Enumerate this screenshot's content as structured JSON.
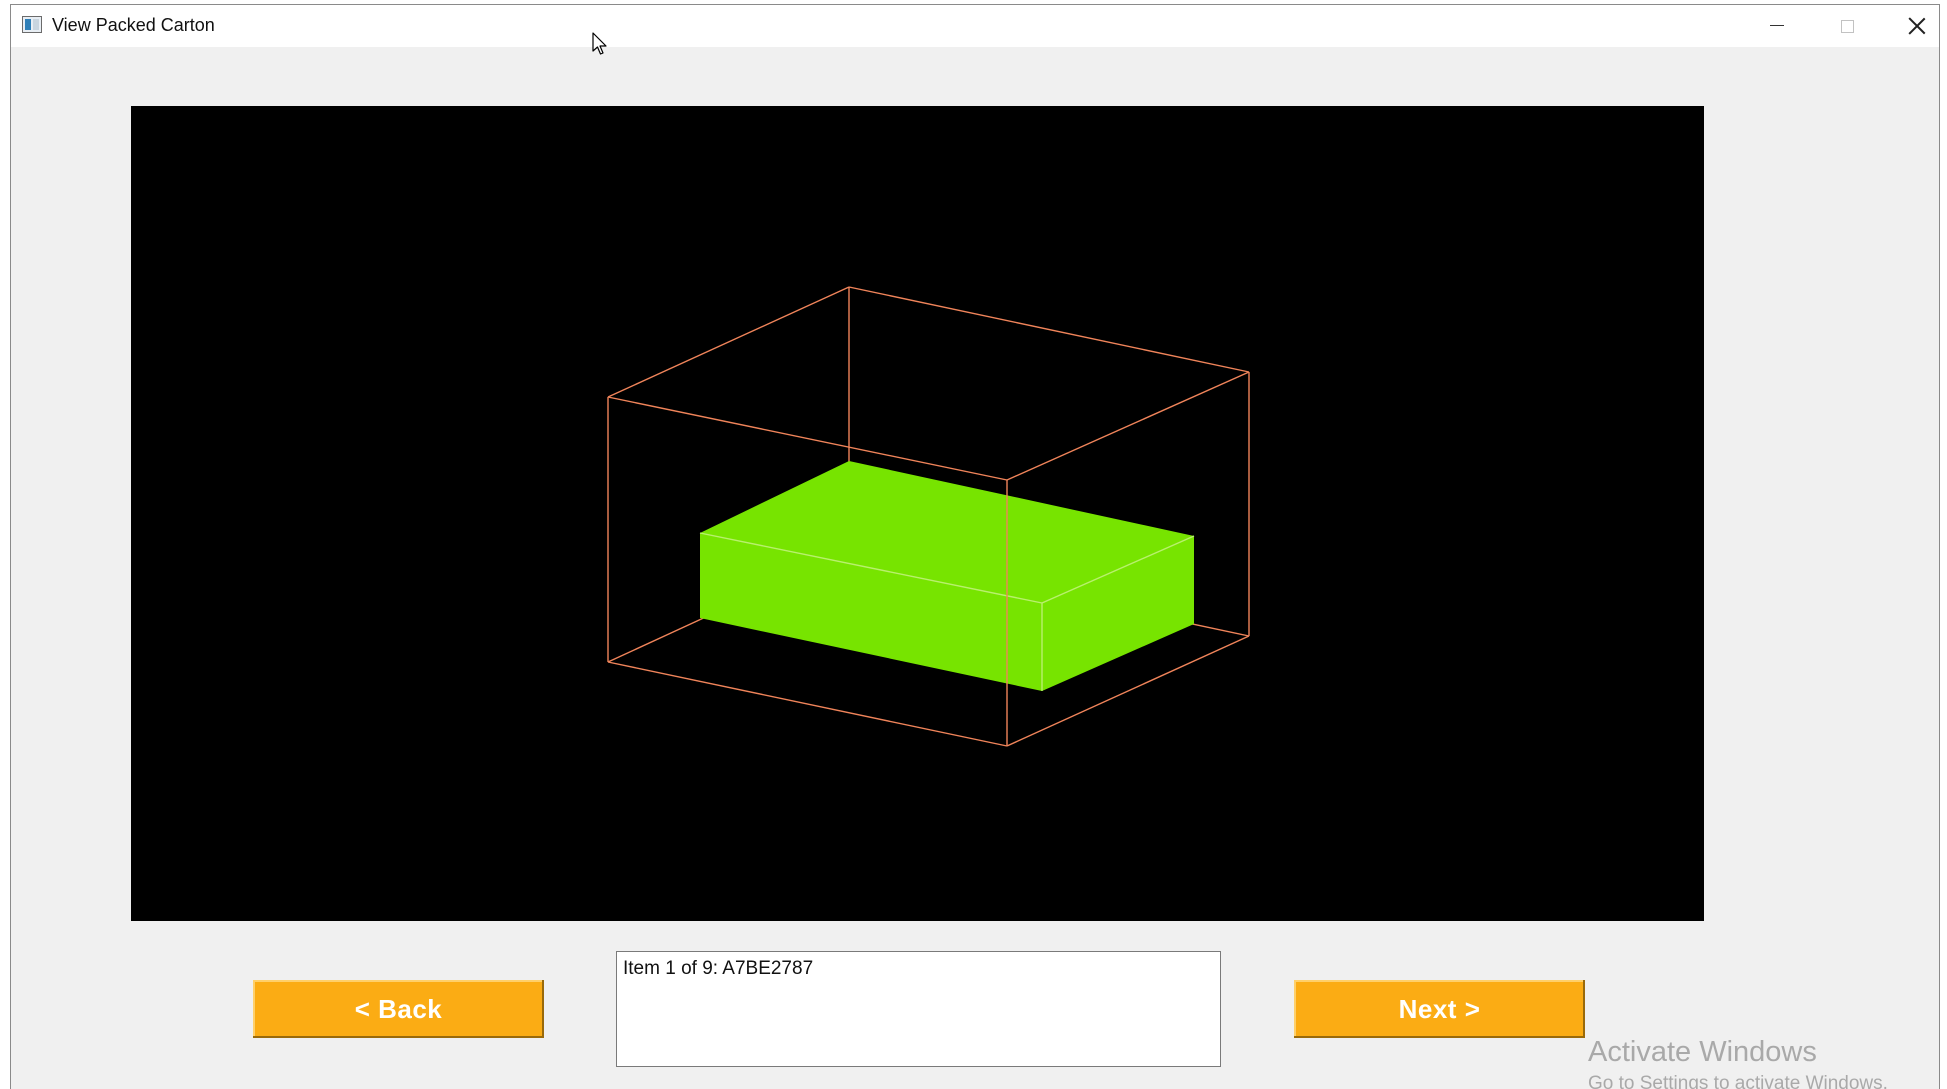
{
  "window": {
    "title": "View Packed Carton"
  },
  "controls": {
    "back_label": "< Back",
    "next_label": "Next >",
    "item_text": "Item 1 of 9: A7BE2787"
  },
  "viewer": {
    "background": "#000000",
    "carton_edge_color": "#f0845a",
    "item_fill_color": "#77e400",
    "item_edge_color": "#b9f06e"
  },
  "watermark": {
    "title": "Activate Windows",
    "subtitle": "Go to Settings to activate Windows."
  },
  "colors": {
    "button_fill": "#fbac14",
    "button_text": "#ffffff",
    "window_bg": "#f0f0f0"
  }
}
